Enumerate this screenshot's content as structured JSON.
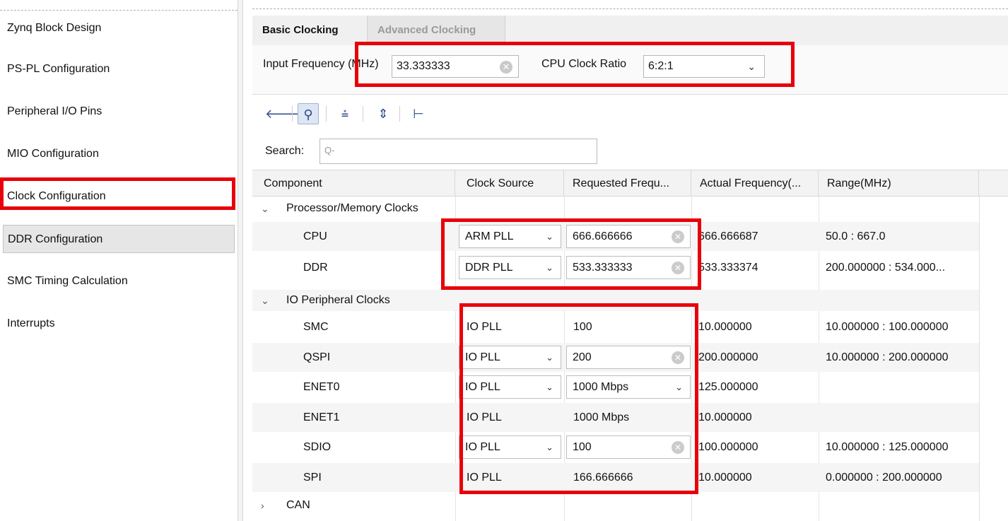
{
  "sidebar": {
    "items": [
      {
        "label": "Zynq Block Design"
      },
      {
        "label": "PS-PL Configuration"
      },
      {
        "label": "Peripheral I/O Pins"
      },
      {
        "label": "MIO Configuration"
      },
      {
        "label": "Clock Configuration"
      },
      {
        "label": "DDR Configuration"
      },
      {
        "label": "SMC Timing Calculation"
      },
      {
        "label": "Interrupts"
      }
    ]
  },
  "tabs": [
    {
      "label": "Basic Clocking"
    },
    {
      "label": "Advanced Clocking"
    }
  ],
  "basic": {
    "input_freq_label": "Input Frequency (MHz)",
    "input_freq_value": "33.333333",
    "cpu_ratio_label": "CPU Clock Ratio",
    "cpu_ratio_value": "6:2:1"
  },
  "toolbar": {
    "icons": [
      "back-arrow-icon",
      "search-icon",
      "collapse-all-icon",
      "expand-all-icon",
      "hierarchy-icon"
    ]
  },
  "search": {
    "label": "Search:",
    "placeholder": "Q-"
  },
  "table": {
    "headers": [
      "Component",
      "Clock Source",
      "Requested Frequ...",
      "Actual Frequency(...",
      "Range(MHz)"
    ],
    "groups": {
      "processor": "Processor/Memory Clocks",
      "io": "IO Peripheral Clocks",
      "can": "CAN"
    },
    "rows": {
      "cpu": {
        "component": "CPU",
        "source": "ARM PLL",
        "requested": "666.666666",
        "actual": "666.666687",
        "range": "50.0 : 667.0"
      },
      "ddr": {
        "component": "DDR",
        "source": "DDR PLL",
        "requested": "533.333333",
        "actual": "533.333374",
        "range": "200.000000 : 534.000..."
      },
      "smc": {
        "component": "SMC",
        "source": "IO PLL",
        "requested": "100",
        "actual": "10.000000",
        "range": "10.000000 : 100.000000"
      },
      "qspi": {
        "component": "QSPI",
        "source": "IO PLL",
        "requested": "200",
        "actual": "200.000000",
        "range": "10.000000 : 200.000000"
      },
      "enet0": {
        "component": "ENET0",
        "source": "IO PLL",
        "requested": "1000 Mbps",
        "actual": "125.000000",
        "range": ""
      },
      "enet1": {
        "component": "ENET1",
        "source": "IO PLL",
        "requested": "1000 Mbps",
        "actual": "10.000000",
        "range": ""
      },
      "sdio": {
        "component": "SDIO",
        "source": "IO PLL",
        "requested": "100",
        "actual": "100.000000",
        "range": "10.000000 : 125.000000"
      },
      "spi": {
        "component": "SPI",
        "source": "IO PLL",
        "requested": "166.666666",
        "actual": "10.000000",
        "range": "0.000000 : 200.000000"
      }
    }
  },
  "colors": {
    "highlight": "#e8000b",
    "accent": "#2b4a8a"
  }
}
